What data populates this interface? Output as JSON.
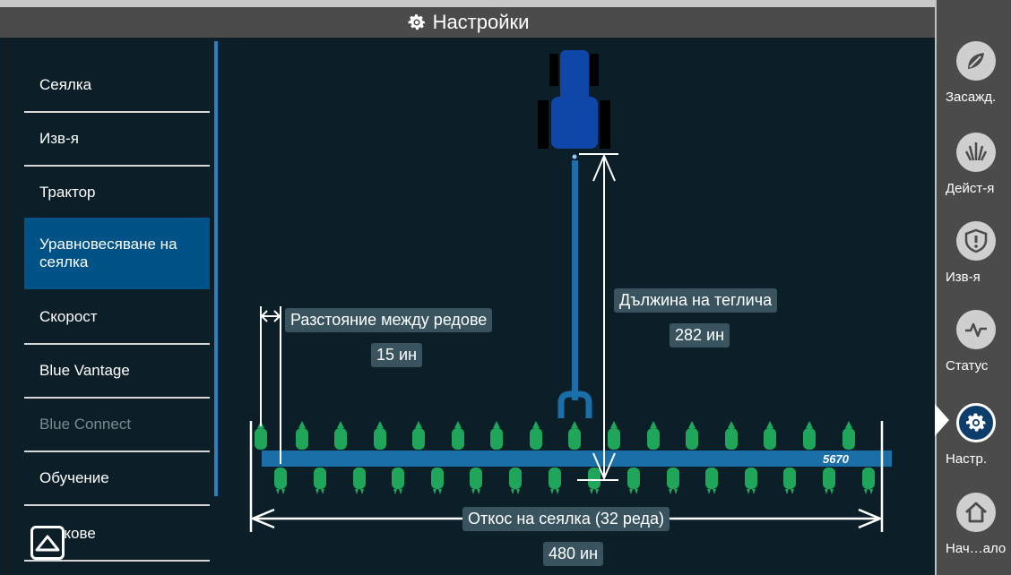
{
  "header": {
    "title": "Настройки"
  },
  "sidebar": {
    "items": [
      {
        "label": "Сеялка"
      },
      {
        "label": "Изв-я"
      },
      {
        "label": "Трактор"
      },
      {
        "label": "Уравновесяване на сеялка"
      },
      {
        "label": "Скорост"
      },
      {
        "label": "Blue Vantage"
      },
      {
        "label": "Blue Connect"
      },
      {
        "label": "Обучение"
      },
      {
        "label": "Звукове"
      }
    ]
  },
  "diagram": {
    "row_spacing_label": "Разстояние между редове",
    "row_spacing_value": "15 ин",
    "hitch_length_label": "Дължина на теглича",
    "hitch_length_value": "282 ин",
    "width_label": "Откос на сеялка (32 реда)",
    "width_value": "480 ин",
    "model": "5670"
  },
  "nav": {
    "items": [
      {
        "label": "Засажд.",
        "icon": "planting-icon"
      },
      {
        "label": "Дейст-я",
        "icon": "actions-icon"
      },
      {
        "label": "Изв-я",
        "icon": "alerts-icon"
      },
      {
        "label": "Статус",
        "icon": "status-icon"
      },
      {
        "label": "Настр.",
        "icon": "gear-icon"
      },
      {
        "label": "Нач…ало",
        "icon": "home-icon"
      }
    ]
  },
  "colors": {
    "accent": "#005287",
    "planter_bar": "#1b6fa8",
    "row_unit": "#1fa65a",
    "tractor": "#0f47a8"
  }
}
